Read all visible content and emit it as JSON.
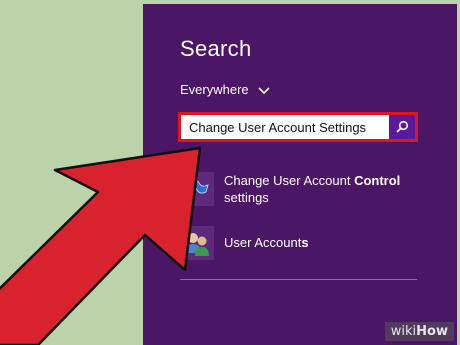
{
  "panel": {
    "title": "Search",
    "scope_label": "Everywhere",
    "search_value": "Change User Account Settings"
  },
  "results": [
    {
      "label_prefix": "Change User Account ",
      "label_match": "Control",
      "label_suffix": "settings",
      "icon": "flag-icon"
    },
    {
      "label_prefix": "User Account",
      "label_match": "s",
      "icon": "users-icon"
    }
  ],
  "watermark": {
    "part1": "wiki",
    "part2": "How"
  },
  "colors": {
    "panel": "#4b1666",
    "highlight_border": "#e0161f",
    "arrow": "#d8232f",
    "background": "#bcd3a9"
  }
}
